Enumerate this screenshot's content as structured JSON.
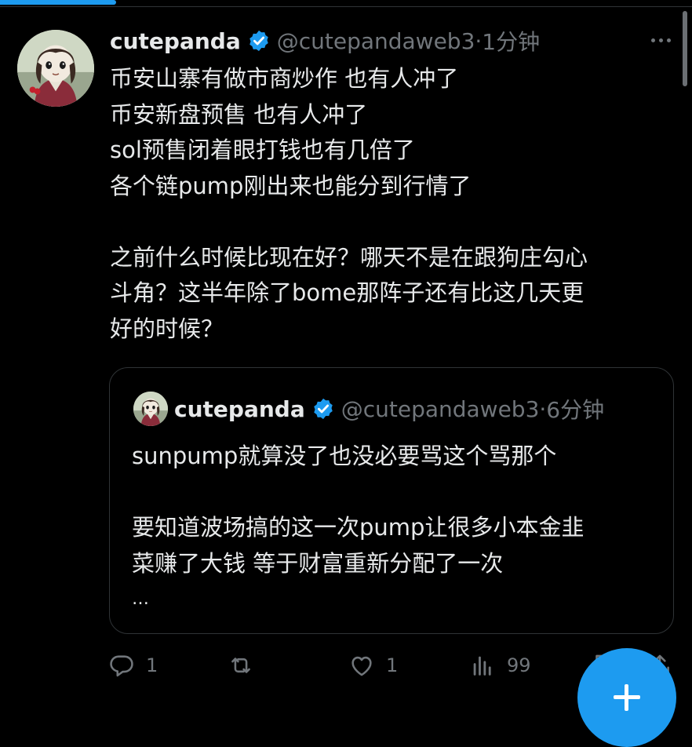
{
  "tweet": {
    "author_name": "cutepanda",
    "handle": "@cutepandaweb3",
    "separator": "·",
    "time": "1分钟",
    "lines": [
      "币安山寨有做市商炒作 也有人冲了",
      "币安新盘预售 也有人冲了",
      "sol预售闭着眼打钱也有几倍了",
      "各个链pump刚出来也能分到行情了",
      "",
      "之前什么时候比现在好？哪天不是在跟狗庄勾心",
      "斗角？这半年除了bome那阵子还有比这几天更",
      "好的时候？"
    ]
  },
  "quoted_tweet": {
    "author_name": "cutepanda",
    "handle": "@cutepandaweb3",
    "separator": "·",
    "time": "6分钟",
    "lines": [
      "sunpump就算没了也没必要骂这个骂那个",
      "",
      "要知道波场搞的这一次pump让很多小本金韭",
      "菜赚了大钱 等于财富重新分配了一次"
    ],
    "ellipsis": "…"
  },
  "actions": {
    "reply_count": "1",
    "retweet_count": "",
    "like_count": "1",
    "views_count": "99"
  },
  "icons": {
    "verified": "verified-badge-icon",
    "more": "more-options-icon",
    "reply": "reply-icon",
    "retweet": "retweet-icon",
    "like": "heart-icon",
    "views": "views-chart-icon",
    "bookmark": "bookmark-icon",
    "share": "share-icon",
    "compose": "plus-icon"
  },
  "colors": {
    "background": "#000000",
    "text": "#e7e9ea",
    "muted": "#71767b",
    "accent": "#1d9bf0",
    "border": "#2f3336"
  }
}
